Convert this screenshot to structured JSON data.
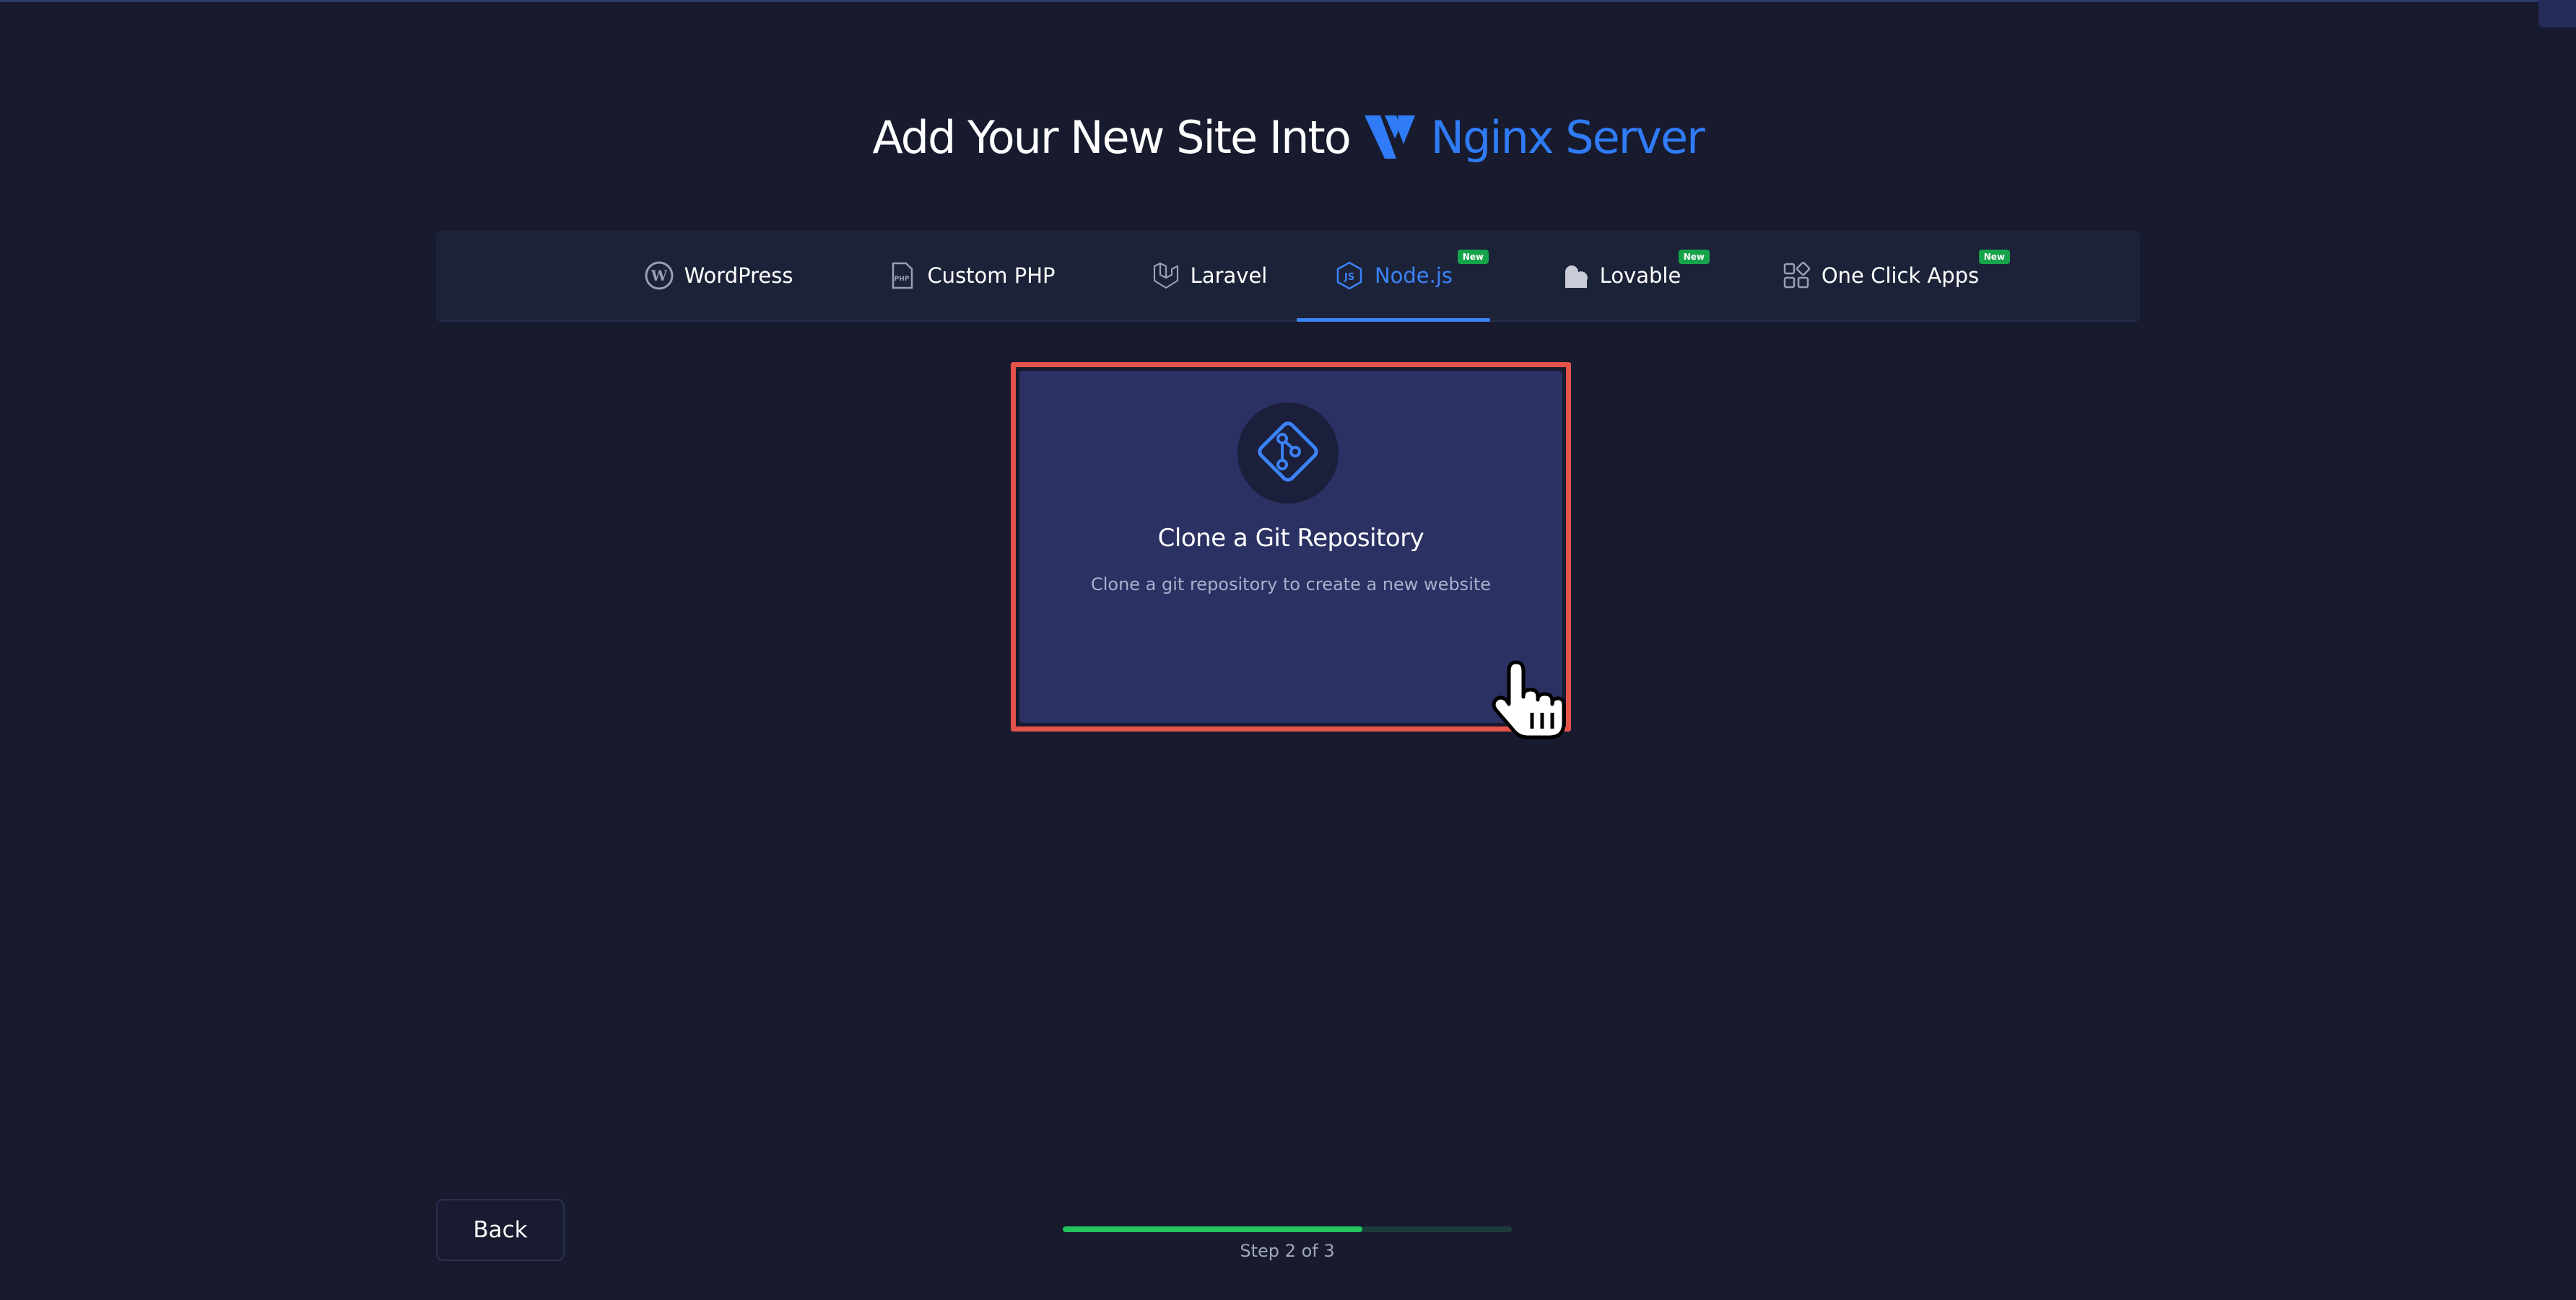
{
  "page": {
    "title_prefix": "Add Your New Site Into",
    "title_server": "Nginx Server"
  },
  "tabs": [
    {
      "label": "WordPress",
      "icon": "wordpress-icon",
      "active": false,
      "badge": ""
    },
    {
      "label": "Custom PHP",
      "icon": "php-file-icon",
      "active": false,
      "badge": ""
    },
    {
      "label": "Laravel",
      "icon": "laravel-icon",
      "active": false,
      "badge": ""
    },
    {
      "label": "Node.js",
      "icon": "nodejs-icon",
      "active": true,
      "badge": "New"
    },
    {
      "label": "Lovable",
      "icon": "lovable-icon",
      "active": false,
      "badge": "New"
    },
    {
      "label": "One Click Apps",
      "icon": "apps-grid-icon",
      "active": false,
      "badge": "New"
    }
  ],
  "card": {
    "title": "Clone a Git Repository",
    "description": "Clone a git repository to create a new website",
    "icon": "git-icon"
  },
  "footer": {
    "back_label": "Back",
    "progress": 0.667,
    "step_label": "Step 2 of 3"
  },
  "colors": {
    "background": "#181a2e",
    "accent": "#3b82f6",
    "badge": "#16a34a",
    "card": "#2b3163",
    "highlight": "#e5534b",
    "progress": "#22c55e"
  }
}
